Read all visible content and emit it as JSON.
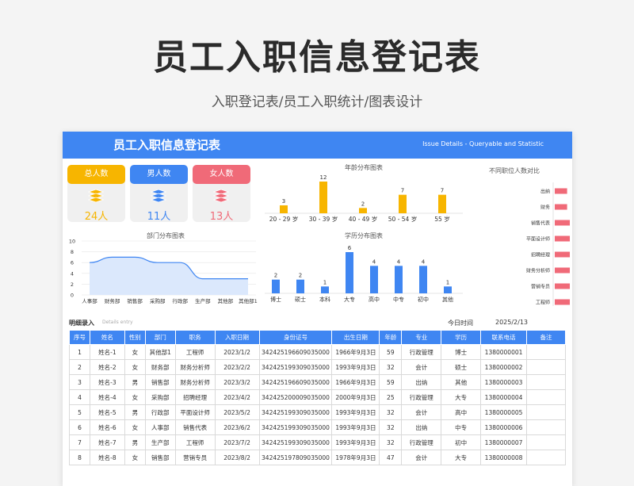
{
  "page": {
    "title": "员工入职信息登记表",
    "subtitle": "入职登记表/员工入职统计/图表设计"
  },
  "banner": {
    "title": "员工入职信息登记表",
    "subtitle": "Issue Details - Queryable and Statistic"
  },
  "colors": {
    "total": "#f7b500",
    "male": "#3f86f2",
    "female": "#f06a78",
    "banner": "#3f86f2"
  },
  "cards": [
    {
      "label": "总人数",
      "value": "24人",
      "icon": "stack-icon",
      "color": "#f7b500"
    },
    {
      "label": "男人数",
      "value": "11人",
      "icon": "stack-icon",
      "color": "#3f86f2"
    },
    {
      "label": "女人数",
      "value": "13人",
      "icon": "stack-icon",
      "color": "#f06a78"
    }
  ],
  "chart_data": [
    {
      "type": "bar",
      "title": "年龄分布图表",
      "categories": [
        "20 - 29 岁",
        "30 - 39 岁",
        "40 - 49 岁",
        "50 - 54 岁",
        "55 岁"
      ],
      "values": [
        3,
        12,
        2,
        7,
        7
      ],
      "color": "#f7b500"
    },
    {
      "type": "bar",
      "orientation": "horizontal",
      "title": "不同职位人数对比",
      "categories": [
        "出纳",
        "财务",
        "销售代表",
        "平面设计师",
        "招聘经理",
        "财务分析师",
        "营销专员",
        "工程师"
      ],
      "values": [
        1,
        1,
        2,
        5,
        4,
        4,
        3,
        2
      ],
      "color": "#f06a78"
    },
    {
      "type": "area",
      "title": "部门分布图表",
      "categories": [
        "人事部",
        "财务部",
        "销售部",
        "采购部",
        "行政部",
        "生产部",
        "其他部",
        "其他部1"
      ],
      "values": [
        6,
        7,
        7,
        6,
        6,
        3,
        3,
        3
      ],
      "ylim": [
        0,
        10
      ],
      "yticks": [
        "10",
        "8",
        "6",
        "4",
        "2",
        "0"
      ],
      "color": "#3f86f2"
    },
    {
      "type": "bar",
      "title": "学历分布图表",
      "categories": [
        "博士",
        "硕士",
        "本科",
        "大专",
        "高中",
        "中专",
        "初中",
        "其他"
      ],
      "values": [
        2,
        2,
        1,
        6,
        4,
        4,
        4,
        1
      ],
      "color": "#3f86f2"
    }
  ],
  "table_section": {
    "title": "明细录入",
    "subtitle": "Details entry",
    "today_label": "今日时间",
    "today_value": "2025/2/13"
  },
  "table": {
    "headers": [
      "序号",
      "姓名",
      "性别",
      "部门",
      "职务",
      "入职日期",
      "身份证号",
      "出生日期",
      "年龄",
      "专业",
      "学历",
      "联系电话",
      "备注"
    ],
    "rows": [
      [
        "1",
        "姓名-1",
        "女",
        "其他部1",
        "工程师",
        "2023/1/2",
        "342425196609035000",
        "1966年9月3日",
        "59",
        "行政管理",
        "博士",
        "1380000001",
        ""
      ],
      [
        "2",
        "姓名-2",
        "女",
        "财务部",
        "财务分析师",
        "2023/2/2",
        "342425199309035000",
        "1993年9月3日",
        "32",
        "会计",
        "硕士",
        "1380000002",
        ""
      ],
      [
        "3",
        "姓名-3",
        "男",
        "销售部",
        "财务分析师",
        "2023/3/2",
        "342425196609035000",
        "1966年9月3日",
        "59",
        "出纳",
        "其他",
        "1380000003",
        ""
      ],
      [
        "4",
        "姓名-4",
        "女",
        "采购部",
        "招聘经理",
        "2023/4/2",
        "342425200009035000",
        "2000年9月3日",
        "25",
        "行政管理",
        "大专",
        "1380000004",
        ""
      ],
      [
        "5",
        "姓名-5",
        "男",
        "行政部",
        "平面设计师",
        "2023/5/2",
        "342425199309035000",
        "1993年9月3日",
        "32",
        "会计",
        "高中",
        "1380000005",
        ""
      ],
      [
        "6",
        "姓名-6",
        "女",
        "人事部",
        "销售代表",
        "2023/6/2",
        "342425199309035000",
        "1993年9月3日",
        "32",
        "出纳",
        "中专",
        "1380000006",
        ""
      ],
      [
        "7",
        "姓名-7",
        "男",
        "生产部",
        "工程师",
        "2023/7/2",
        "342425199309035000",
        "1993年9月3日",
        "32",
        "行政管理",
        "初中",
        "1380000007",
        ""
      ],
      [
        "8",
        "姓名-8",
        "女",
        "销售部",
        "营销专员",
        "2023/8/2",
        "342425197809035000",
        "1978年9月3日",
        "47",
        "会计",
        "大专",
        "1380000008",
        ""
      ]
    ]
  }
}
